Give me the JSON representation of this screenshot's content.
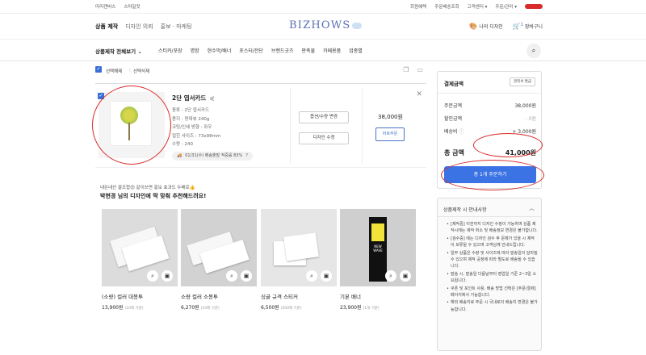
{
  "topbar": {
    "left_links": [
      "미리캔버스",
      "스마일컷"
    ],
    "right_links": [
      "회원혜택",
      "주문배송조회",
      "고객센터 ▾",
      "주문/관리 ▾"
    ]
  },
  "header": {
    "nav": [
      "상품 제작",
      "디자인 의뢰",
      "홍보 · 마케팅"
    ],
    "logo": "BIZHOWS",
    "my_design": "나의 디자인",
    "cart": "장바구니",
    "cart_count": "1"
  },
  "categories": {
    "all_label": "상품제작 전체보기",
    "items": [
      "스티커/포장",
      "명함",
      "현수막/배너",
      "포스터/전단",
      "브랜드굿즈",
      "판촉물",
      "카페용품",
      "업종별"
    ]
  },
  "selection": {
    "select_all": "선택해제",
    "delete_selected": "선택삭제"
  },
  "item": {
    "name": "2단 엽서카드",
    "specs": [
      "종류 : 2단 엽서카드",
      "용지 : 랑데뷰 240g",
      "코팅/인쇄 방향 : 좌우",
      "접힌 사이즈 : 73x98mm",
      "수량 : 240"
    ],
    "shipping": "01/31(수) 배송출발 적중률 83%",
    "shipping_help": "?",
    "option_button": "옵션/수량 변경",
    "design_button": "디자인 수정",
    "price": "38,000원",
    "quick_order": "바로주문"
  },
  "recommend": {
    "subtitle": "내돈내산 꿀조합😍 같이쓰면 홍보 효과도 두배로👍",
    "title": "박현경 님의 디자인에 딱 맞춰 추천해드려요!",
    "products": [
      {
        "name": "(소량) 컬러 대봉투",
        "price": "13,900원",
        "unit": "(10매 기준)"
      },
      {
        "name": "소량 컬러 소봉투",
        "price": "6,270원",
        "unit": "(10매 기준)"
      },
      {
        "name": "싱글 규격 스티커",
        "price": "6,500원",
        "unit": "(500매 기준)"
      },
      {
        "name": "기본 배너",
        "price": "23,900원",
        "unit": "(1개 기준)"
      }
    ],
    "banner_text": "NEW WAVE"
  },
  "summary": {
    "title": "결제금액",
    "discount_button": "견적서 발급",
    "rows": [
      {
        "label": "주문금액",
        "value": "38,000원"
      },
      {
        "label": "할인금액",
        "value": "- 0원"
      },
      {
        "label": "배송비",
        "value": "+ 3,000원"
      }
    ],
    "total_label": "총 금액",
    "total_value": "41,000원",
    "order_button": "총 1개 주문하기"
  },
  "guide": {
    "title": "상품제작 시 안내사항",
    "items": [
      "[제작중] 이전까지 디자인 수정이 가능하며 상품 제작시에는 제작 취소 및 배송정보 변경은 불가합니다.",
      "[검수중] 에는 디자인 검수 후 문제가 있을 시 제작이 보류될 수 있으며 고객님께 안내드립니다.",
      "일부 상품은 수량 및 사이즈에 따라 발송일이 달라질 수 있으며 제작 공정에 따라 별도로 배송될 수 있습니다.",
      "발송 시, 발송일 다음날부터 영업일 기준 2~3일 소요됩니다.",
      "쿠폰 및 포인트 사용, 배송 방법 선택은 [주문/결제] 페이지에서 가능합니다.",
      "해외 배송지로 주문 시 국내로의 배송지 변경은 불가능합니다."
    ]
  }
}
